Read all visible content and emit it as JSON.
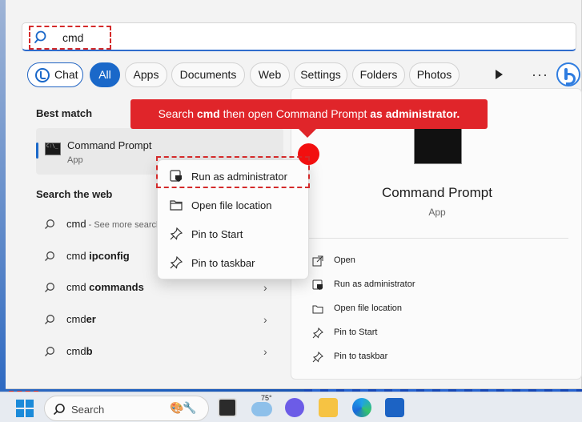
{
  "search": {
    "query": "cmd"
  },
  "filters": [
    "Chat",
    "All",
    "Apps",
    "Documents",
    "Web",
    "Settings",
    "Folders",
    "Photos"
  ],
  "left": {
    "best_match_label": "Best match",
    "best_match": {
      "title": "Command Prompt",
      "subtitle": "App"
    },
    "search_web_label": "Search the web",
    "web_items": [
      {
        "prefix": "cmd",
        "bold": "",
        "sub": " - See more search"
      },
      {
        "prefix": "cmd ",
        "bold": "ipconfig",
        "sub": ""
      },
      {
        "prefix": "cmd ",
        "bold": "commands",
        "sub": ""
      },
      {
        "prefix": "cmd",
        "bold": "er",
        "sub": ""
      },
      {
        "prefix": "cmd",
        "bold": "b",
        "sub": ""
      }
    ]
  },
  "callout": {
    "part1": "Search ",
    "bold1": "cmd",
    "part2": " then open Command Prompt ",
    "bold2": "as administrator."
  },
  "context_menu": [
    "Run as administrator",
    "Open file location",
    "Pin to Start",
    "Pin to taskbar"
  ],
  "preview": {
    "title": "Command Prompt",
    "subtitle": "App",
    "actions": [
      "Open",
      "Run as administrator",
      "Open file location",
      "Pin to Start",
      "Pin to taskbar"
    ]
  },
  "taskbar": {
    "search_placeholder": "Search",
    "weather_temp": "75°"
  },
  "colors": {
    "accent": "#1a68c9",
    "callout": "#e0252a",
    "highlight_dash": "#d42a2a"
  }
}
